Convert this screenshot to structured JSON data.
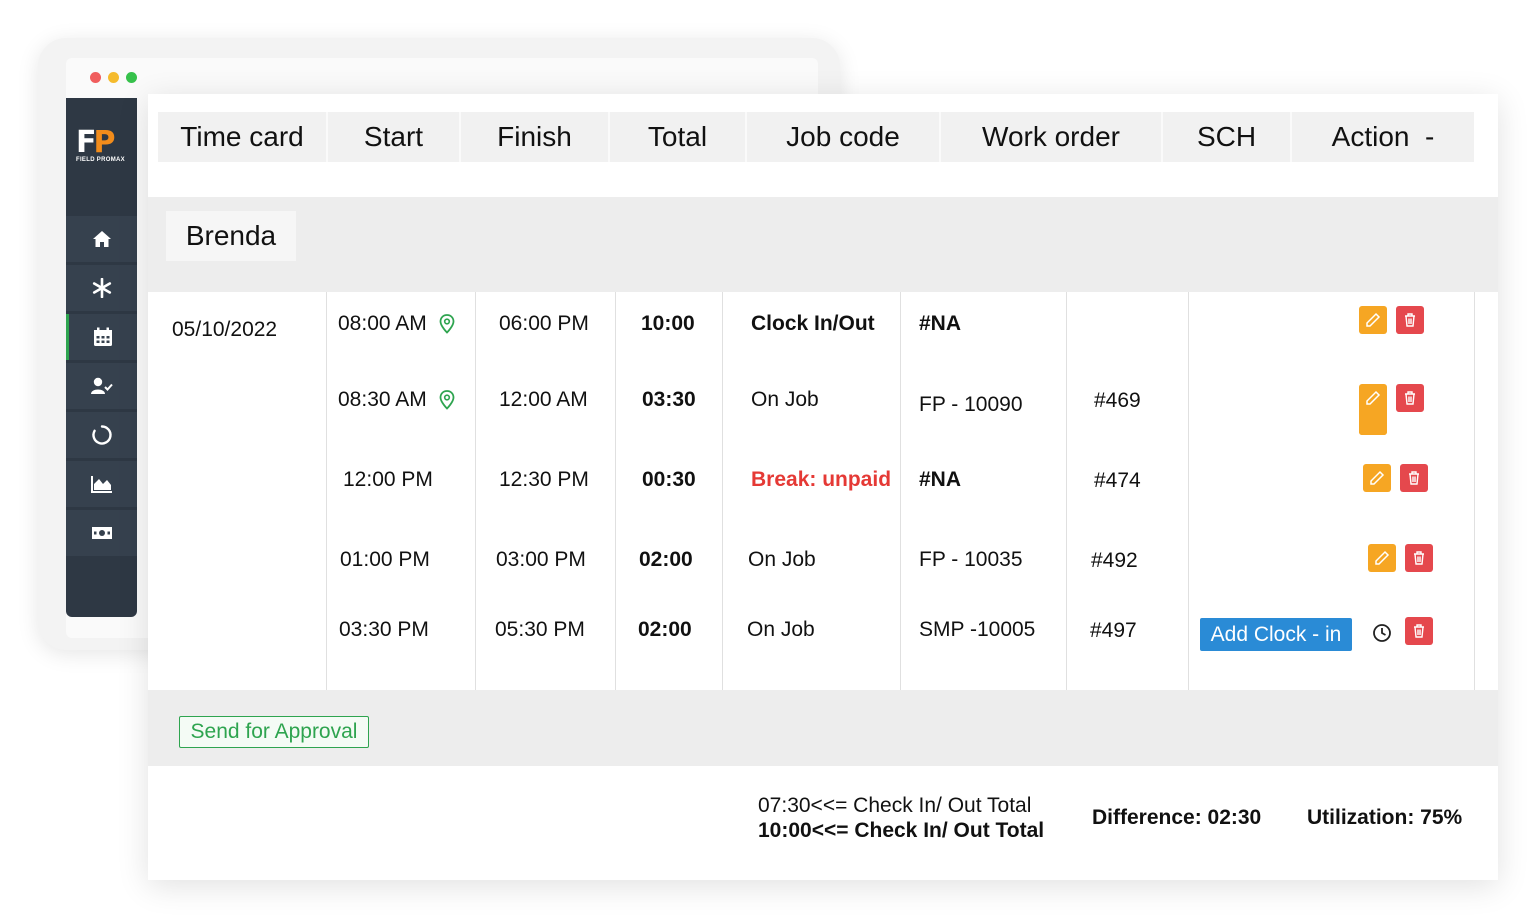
{
  "colors": {
    "accent_orange": "#f6a623",
    "delete_red": "#e5484d",
    "blue": "#2a8bd6",
    "green": "#2ea44f",
    "sidebar": "#2e3844"
  },
  "logo": {
    "text": "FIELD PROMAX"
  },
  "sidebar": {
    "icons": [
      "home-icon",
      "asterisk-icon",
      "calendar-icon",
      "user-check-icon",
      "refresh-icon",
      "chart-icon",
      "money-icon"
    ]
  },
  "table": {
    "headers": [
      "Time card",
      "Start",
      "Finish",
      "Total",
      "Job code",
      "Work order",
      "SCH",
      "Action  -"
    ],
    "employee": "Brenda",
    "date": "05/10/2022",
    "rows": [
      {
        "start": "08:00 AM",
        "finish": "06:00 PM",
        "total": "10:00",
        "job_code": "Clock In/Out",
        "work_order": "#NA",
        "sch": ""
      },
      {
        "start": "08:30 AM",
        "finish": "12:00 AM",
        "total": "03:30",
        "job_code": "On Job",
        "work_order": "FP - 10090",
        "sch": "#469"
      },
      {
        "start": "12:00 PM",
        "finish": "12:30 PM",
        "total": "00:30",
        "job_code": "Break: unpaid",
        "work_order": "#NA",
        "sch": "#474"
      },
      {
        "start": "01:00 PM",
        "finish": "03:00 PM",
        "total": "02:00",
        "job_code": "On Job",
        "work_order": "FP - 10035",
        "sch": "#492"
      },
      {
        "start": "03:30 PM",
        "finish": "05:30 PM",
        "total": "02:00",
        "job_code": "On Job",
        "work_order": "SMP -10005",
        "sch": "#497"
      }
    ],
    "add_clock_label": "Add Clock - in"
  },
  "approval": {
    "label": "Send for Approval"
  },
  "summary": {
    "line1": "07:30<<= Check In/ Out Total",
    "line2": "10:00<<= Check In/ Out Total",
    "difference": "Difference: 02:30",
    "utilization": "Utilization: 75%"
  }
}
